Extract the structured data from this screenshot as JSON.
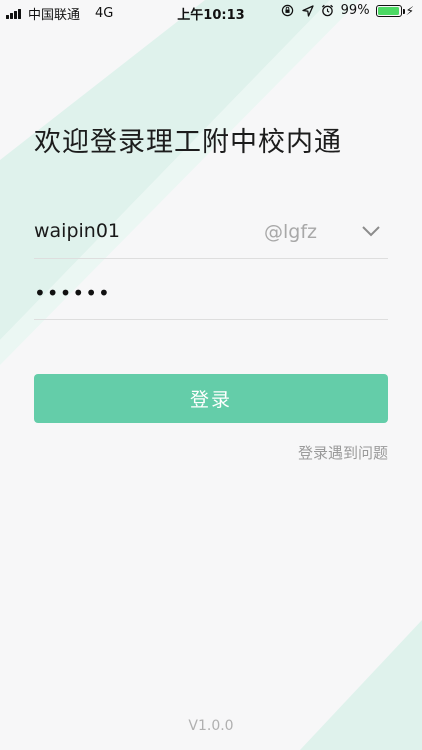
{
  "status_bar": {
    "carrier": "中国联通",
    "network": "4G",
    "time": "上午10:13",
    "battery_percent": "99%",
    "battery_level": 0.99,
    "icons": [
      "signal-icon",
      "orientation-lock-icon",
      "location-icon",
      "alarm-icon",
      "battery-icon",
      "charging-icon"
    ]
  },
  "login": {
    "title": "欢迎登录理工附中校内通",
    "username_value": "waipin01",
    "domain_value": "@lgfz",
    "password_value": "••••••",
    "login_button_label": "登录",
    "help_link": "登录遇到问题"
  },
  "footer": {
    "version": "V1.0.0"
  },
  "colors": {
    "accent": "#64cda9",
    "background": "#f7f7f8",
    "decor": "#dcf1ea",
    "muted_text": "#9a9a9a",
    "divider": "#dedede"
  }
}
